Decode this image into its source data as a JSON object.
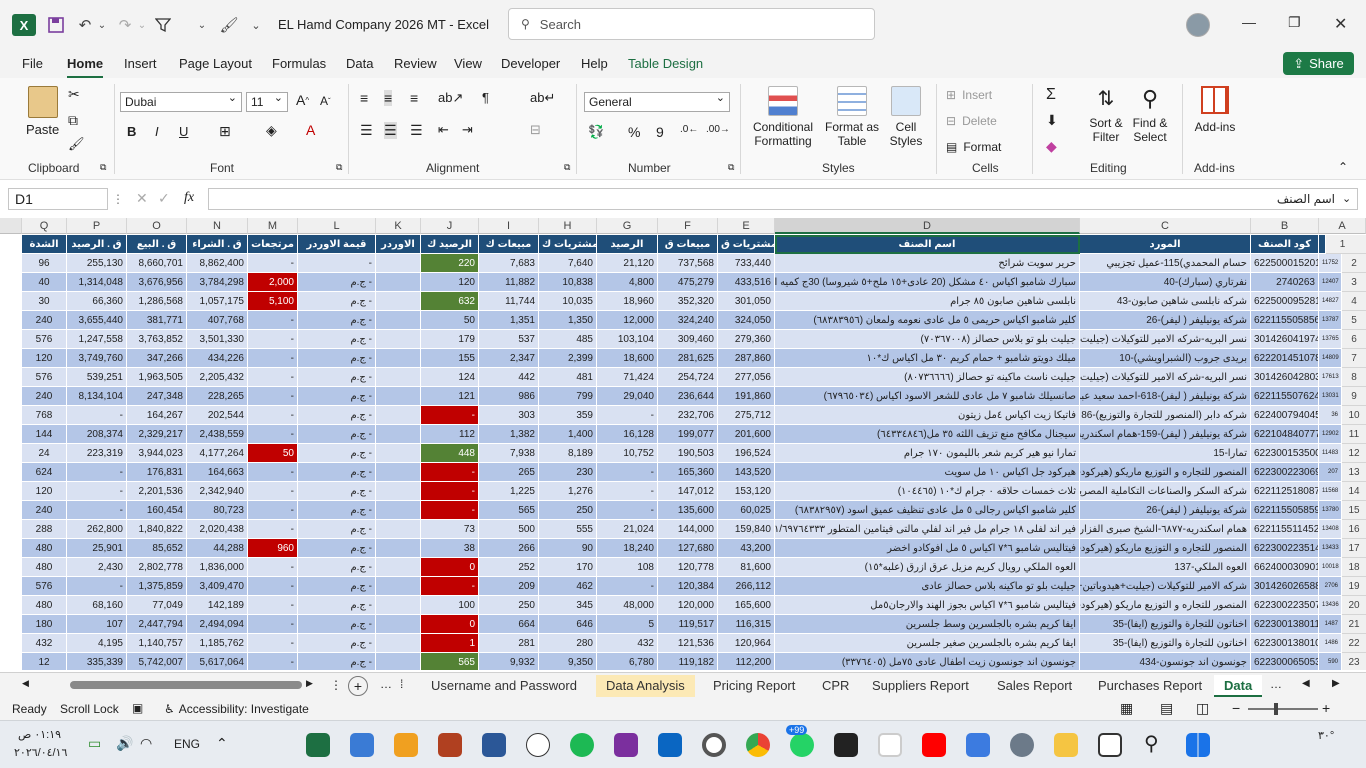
{
  "titlebar": {
    "title": "EL Hamd Company 2026  MT  -  Excel",
    "search_placeholder": "Search"
  },
  "ribbon_tabs": [
    "File",
    "Home",
    "Insert",
    "Page Layout",
    "Formulas",
    "Data",
    "Review",
    "View",
    "Developer",
    "Help",
    "Table Design"
  ],
  "share_label": "Share",
  "ribbon": {
    "clipboard": {
      "label": "Clipboard",
      "paste": "Paste"
    },
    "font": {
      "label": "Font",
      "name": "Dubai",
      "size": "11",
      "bold": "B",
      "italic": "I",
      "underline": "U"
    },
    "alignment": {
      "label": "Alignment"
    },
    "number": {
      "label": "Number",
      "format": "General"
    },
    "styles": {
      "label": "Styles",
      "conditional": "Conditional",
      "conditional2": "Formatting",
      "format_as": "Format as",
      "format_as2": "Table",
      "cell_styles": "Cell",
      "cell_styles2": "Styles"
    },
    "cells": {
      "label": "Cells",
      "insert": "Insert",
      "delete": "Delete",
      "format": "Format"
    },
    "editing": {
      "label": "Editing",
      "sort": "Sort &",
      "sort2": "Filter",
      "find": "Find &",
      "find2": "Select"
    },
    "addins": {
      "label": "Add-ins",
      "btn": "Add-ins"
    }
  },
  "formula": {
    "namebox": "D1",
    "content": "اسم الصنف",
    "fx": "fx"
  },
  "columns": [
    "Q",
    "P",
    "O",
    "N",
    "M",
    "L",
    "K",
    "J",
    "I",
    "H",
    "G",
    "F",
    "E",
    "D",
    "C",
    "B",
    "A"
  ],
  "headers": {
    "Q": "الشدة",
    "P": "ق . الرصيد",
    "O": "ق . البيع",
    "N": "ق . الشراء",
    "M": "مرتجعات",
    "L": "قيمة الاوردر",
    "K": "الاوردر",
    "J": "الرصيد ك",
    "I": "مبيعات ك",
    "H": "مشتريات ك",
    "G": "الرصيد",
    "F": "مبيعات ق",
    "E": "مشتريات ق",
    "D": "اسم الصنف",
    "C": "المورد",
    "B": "كود الصنف",
    "A": "كود الصنف"
  },
  "rows": [
    {
      "A": "11752",
      "B": "6225000152014",
      "C": "حسام المحمدي)115-عميل تجزيبي",
      "D": "حرير سويت شرائح",
      "E": "733,440",
      "F": "737,568",
      "G": "21,120",
      "H": "7,640",
      "I": "7,683",
      "J": "220",
      "K": "",
      "L": "-",
      "M": "-",
      "N": "8,862,400",
      "O": "8,660,701",
      "P": "255,130",
      "Q": "96"
    },
    {
      "A": "12407",
      "B": "2740263",
      "C": "نفرتاري (سبارك)-40",
      "D": "سبارك شامبو اكياس ٤٠ مشكل (20 عادى+١٥ ملح+٥ شيروسا) 30ج كميه اكبر",
      "E": "433,516",
      "F": "475,279",
      "G": "4,800",
      "H": "10,838",
      "I": "11,882",
      "J": "120",
      "K": "",
      "L": "ج.م -",
      "M": "2,000",
      "N": "3,784,298",
      "O": "3,676,956",
      "P": "1,314,048",
      "Q": "40"
    },
    {
      "A": "14827",
      "B": "6225000952812",
      "C": "شركه نابلسى شاهين صابون-43",
      "D": "نابلسى شاهين صابون ٨٥ جرام",
      "E": "301,050",
      "F": "352,320",
      "G": "18,960",
      "H": "10,035",
      "I": "11,744",
      "J": "632",
      "K": "",
      "L": "ج.م -",
      "M": "5,100",
      "N": "1,057,175",
      "O": "1,286,568",
      "P": "66,360",
      "Q": "30"
    },
    {
      "A": "13787",
      "B": "6221155058560",
      "C": "شركة يونيليفر ( ليفر)-26",
      "D": "كلير شامبو اكياس حريمى ٥ مل عادى نعومه ولمعان (٦٨٣٨٣٩٥٦)",
      "E": "324,050",
      "F": "324,240",
      "G": "12,000",
      "H": "1,350",
      "I": "1,351",
      "J": "50",
      "K": "",
      "L": "ج.م -",
      "M": "-",
      "N": "407,768",
      "O": "381,771",
      "P": "3,655,440",
      "Q": "240"
    },
    {
      "A": "13765",
      "B": "3014260419745",
      "C": "نسر البريه-شركه الامير للتوكيلات (جيليت+هيدو",
      "D": "جيليت بلو تو بلاس حصالز (٧٠٣٦٧٠٠٨)",
      "E": "279,360",
      "F": "309,460",
      "G": "103,104",
      "H": "485",
      "I": "537",
      "J": "179",
      "K": "",
      "L": "ج.م -",
      "M": "-",
      "N": "3,501,330",
      "O": "3,763,852",
      "P": "1,247,558",
      "Q": "576"
    },
    {
      "A": "14809",
      "B": "6222014510786",
      "C": "بريدى جروب (الشبراويشي)-10",
      "D": "ميلك دويتو شامبو + حمام كريم ٣٠ مل اكياس ك*١٠",
      "E": "287,860",
      "F": "281,625",
      "G": "18,600",
      "H": "2,399",
      "I": "2,347",
      "J": "155",
      "K": "",
      "L": "ج.م -",
      "M": "-",
      "N": "434,226",
      "O": "347,266",
      "P": "3,749,760",
      "Q": "120"
    },
    {
      "A": "17613",
      "B": "3014260428037",
      "C": "نسر البريه-شركه الامير للتوكيلات (جيليت+هيدو",
      "D": "جيليت ناسث ماكينه تو حصالز (٨٠٧٣٦٦٦٦)",
      "E": "277,056",
      "F": "254,724",
      "G": "71,424",
      "H": "481",
      "I": "442",
      "J": "124",
      "K": "",
      "L": "ج.م -",
      "M": "-",
      "N": "2,205,432",
      "O": "1,963,505",
      "P": "539,251",
      "Q": "576"
    },
    {
      "A": "13031",
      "B": "6221155076243",
      "C": "شركة يونيليفر ( ليفر)-618-احمد سعيد عبد المجيد",
      "D": "صانسيلك شامبو ٧ مل عادى للشعر الاسود اكياس (٦٧٩٦٥٠٣٤)",
      "E": "191,860",
      "F": "236,644",
      "G": "29,040",
      "H": "799",
      "I": "986",
      "J": "121",
      "K": "",
      "L": "ج.م -",
      "M": "-",
      "N": "228,265",
      "O": "247,348",
      "P": "8,134,104",
      "Q": "240"
    },
    {
      "A": "36",
      "B": "6224007940457",
      "C": "شركه دابر (المنصور للتجارة والتوزيع)-86",
      "D": "فاتيكا زيت اكياس ٤مل زيتون",
      "E": "275,712",
      "F": "232,706",
      "G": "-",
      "H": "359",
      "I": "303",
      "J": "-",
      "K": "",
      "L": "ج.م -",
      "M": "-",
      "N": "202,544",
      "O": "164,267",
      "P": "-",
      "Q": "768"
    },
    {
      "A": "12902",
      "B": "6221048407772",
      "C": "شركة يونيليفر ( ليفر)-159-همام اسكندريه-26",
      "D": "سيجنال مكافح منع تزيف اللثه ٣٥ مل(٦٤٣٣٤٨٤٦)",
      "E": "201,600",
      "F": "199,077",
      "G": "16,128",
      "H": "1,400",
      "I": "1,382",
      "J": "112",
      "K": "",
      "L": "ج.م -",
      "M": "-",
      "N": "2,438,559",
      "O": "2,329,217",
      "P": "208,374",
      "Q": "144"
    },
    {
      "A": "11483",
      "B": "6223001535009",
      "C": "تمارا-15",
      "D": "تمارا نيو هير كريم شعر بالليمون ١٧٠ جرام",
      "E": "196,524",
      "F": "190,503",
      "G": "10,752",
      "H": "8,189",
      "I": "7,938",
      "J": "448",
      "K": "",
      "L": "ج.م -",
      "M": "50",
      "N": "4,177,264",
      "O": "3,944,023",
      "P": "223,319",
      "Q": "24"
    },
    {
      "A": "207",
      "B": "6223002230693",
      "C": "المنصور للتجاره و التوزيع ماريكو (هيركود-فيتاليس",
      "D": "هيركود جل اكياس ١٠ مل سويت",
      "E": "143,520",
      "F": "165,360",
      "G": "-",
      "H": "230",
      "I": "265",
      "J": "-",
      "K": "",
      "L": "ج.م -",
      "M": "-",
      "N": "164,663",
      "O": "176,831",
      "P": "-",
      "Q": "624"
    },
    {
      "A": "11568",
      "B": "6221125180871",
      "C": "شركة السكر والصناعات التكاملية المصريه-88",
      "D": "ثلاث خمسات حلاقه ٠ جرام ك*١٠ (١٠٤٤٦٥)",
      "E": "153,120",
      "F": "147,012",
      "G": "-",
      "H": "1,276",
      "I": "1,225",
      "J": "-",
      "K": "",
      "L": "ج.م -",
      "M": "-",
      "N": "2,342,940",
      "O": "2,201,536",
      "P": "-",
      "Q": "120"
    },
    {
      "A": "13780",
      "B": "6221155058591",
      "C": "شركة يونيليفر ( ليفر)-26",
      "D": "كلير شامبو اكياس رجالى ٥ مل عادى تنظيف عميق اسود (٦٨٣٨٢٩٥٧)",
      "E": "60,025",
      "F": "135,600",
      "G": "-",
      "H": "250",
      "I": "565",
      "J": "-",
      "K": "",
      "L": "ج.م -",
      "M": "-",
      "N": "80,723",
      "O": "160,454",
      "P": "-",
      "Q": "240"
    },
    {
      "A": "13408",
      "B": "6221155114525",
      "C": "همام اسكندريه-٦٨٧٧-الشيخ صبرى الفزاري-٥٨٨-بيتر",
      "D": "فير اند لفلى ١٨ جرام مل فير اند لفلي مالتى فيتامين المتطور ١٩٥٥٠٠٤٤١/٦٩٧٦٤٣٣٣",
      "E": "159,840",
      "F": "144,000",
      "G": "21,024",
      "H": "555",
      "I": "500",
      "J": "73",
      "K": "",
      "L": "ج.م -",
      "M": "-",
      "N": "2,020,438",
      "O": "1,840,822",
      "P": "262,800",
      "Q": "288"
    },
    {
      "A": "13433",
      "B": "6223002235148",
      "C": "المنصور للتجاره و التوزيع ماريكو (هيركود-فيتاليس",
      "D": "فيتاليس شامبو ٦*٧ اكياس ٥ مل افوكادو اخضر",
      "E": "43,200",
      "F": "127,680",
      "G": "18,240",
      "H": "90",
      "I": "266",
      "J": "38",
      "K": "",
      "L": "ج.م -",
      "M": "960",
      "N": "44,288",
      "O": "85,652",
      "P": "25,901",
      "Q": "480"
    },
    {
      "A": "10018",
      "B": "6624000309013",
      "C": "العوه الملكي-137",
      "D": "العوه الملكي رويال كريم مزيل عرق ازرق (علبه*١٥)",
      "E": "81,600",
      "F": "120,778",
      "G": "108",
      "H": "170",
      "I": "252",
      "J": "0",
      "K": "",
      "L": "ج.م -",
      "M": "-",
      "N": "1,836,000",
      "O": "2,802,778",
      "P": "2,430",
      "Q": "480"
    },
    {
      "A": "2706",
      "B": "3014260265885",
      "C": "شركه الامير للتوكيلات (جيليت+هيدوباتين+ورقيات",
      "D": "جيليت بلو تو ماكينه بلاس حصالز عادى",
      "E": "266,112",
      "F": "120,384",
      "G": "-",
      "H": "462",
      "I": "209",
      "J": "-",
      "K": "",
      "L": "ج.م -",
      "M": "-",
      "N": "3,409,470",
      "O": "1,375,859",
      "P": "-",
      "Q": "576"
    },
    {
      "A": "13436",
      "B": "6223002235070",
      "C": "المنصور للتجاره و التوزيع ماريكو (هيركود-فيتاليس",
      "D": "فيتاليس شامبو ٦*٧ اكياس بجوز الهند والارجان٥مل",
      "E": "165,600",
      "F": "120,000",
      "G": "48,000",
      "H": "345",
      "I": "250",
      "J": "100",
      "K": "",
      "L": "ج.م -",
      "M": "-",
      "N": "142,189",
      "O": "77,049",
      "P": "68,160",
      "Q": "480"
    },
    {
      "A": "1487",
      "B": "6223001380115",
      "C": "اخناتون للتجارة والتوزيع (ايفا)-35",
      "D": "ايفا كريم بشره بالجلسرين وسط جلسرين",
      "E": "116,315",
      "F": "119,517",
      "G": "5",
      "H": "646",
      "I": "664",
      "J": "0",
      "K": "",
      "L": "ج.م -",
      "M": "-",
      "N": "2,494,094",
      "O": "2,447,794",
      "P": "107",
      "Q": "180"
    },
    {
      "A": "1486",
      "B": "6223001380108",
      "C": "اخناتون للتجارة والتوزيع (ايفا)-35",
      "D": "ايفا كريم بشره بالجلسرين صغير جلسرين",
      "E": "120,964",
      "F": "121,536",
      "G": "432",
      "H": "280",
      "I": "281",
      "J": "1",
      "K": "",
      "L": "ج.م -",
      "M": "-",
      "N": "1,185,762",
      "O": "1,140,757",
      "P": "4,195",
      "Q": "432"
    },
    {
      "A": "590",
      "B": "6223000650530",
      "C": "جونسون اند جونسون-434",
      "D": "جونسون اند جونسون زيت اطفال عادى ٧٥مل (٣٣٧٦٤٠٥)",
      "E": "112,200",
      "F": "119,182",
      "G": "6,780",
      "H": "9,350",
      "I": "9,932",
      "J": "565",
      "K": "",
      "L": "ج.م -",
      "M": "-",
      "N": "5,617,064",
      "O": "5,742,007",
      "P": "335,339",
      "Q": "12"
    }
  ],
  "sheet_tabs": [
    "Username and Password",
    "Data Analysis",
    "Pricing Report",
    "CPR",
    "Suppliers Report",
    "Sales Report",
    "Purchases Report",
    "Data"
  ],
  "status": {
    "ready": "Ready",
    "scroll_lock": "Scroll Lock",
    "accessibility": "Accessibility: Investigate"
  },
  "taskbar": {
    "time": "٠١:١٩ ص",
    "date": "٢٠٢٦/٠٤/١٦",
    "lang": "ENG",
    "badge": "+99",
    "temp": "٣٠°"
  },
  "colors": {
    "excel_green": "#1d6f42",
    "header_blue": "#1f4e79",
    "row_light": "#d9e1f2",
    "row_dark": "#b4c6e7",
    "red": "#c00000",
    "green": "#548235"
  }
}
